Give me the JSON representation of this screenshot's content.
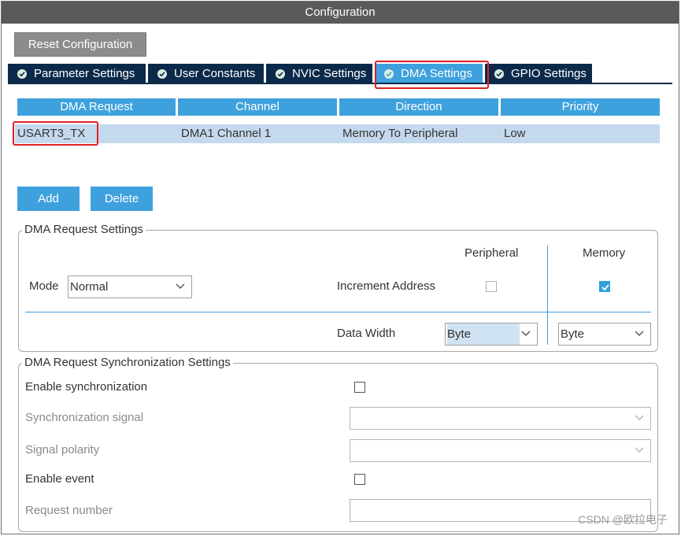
{
  "window": {
    "title": "Configuration"
  },
  "toolbar": {
    "reset_label": "Reset Configuration"
  },
  "tabs": [
    {
      "label": "Parameter Settings",
      "active": false
    },
    {
      "label": "User Constants",
      "active": false
    },
    {
      "label": "NVIC Settings",
      "active": false
    },
    {
      "label": "DMA Settings",
      "active": true
    },
    {
      "label": "GPIO Settings",
      "active": false
    }
  ],
  "dma_table": {
    "headers": [
      "DMA Request",
      "Channel",
      "Direction",
      "Priority"
    ],
    "rows": [
      {
        "request": "USART3_TX",
        "channel": "DMA1 Channel 1",
        "direction": "Memory To Peripheral",
        "priority": "Low"
      }
    ]
  },
  "actions": {
    "add_label": "Add",
    "delete_label": "Delete"
  },
  "request_settings": {
    "legend": "DMA Request Settings",
    "mode_label": "Mode",
    "mode_value": "Normal",
    "peripheral_label": "Peripheral",
    "memory_label": "Memory",
    "increment_label": "Increment Address",
    "peripheral_increment": false,
    "memory_increment": true,
    "data_width_label": "Data Width",
    "peripheral_width": "Byte",
    "memory_width": "Byte"
  },
  "sync_settings": {
    "legend": "DMA Request Synchronization Settings",
    "enable_sync_label": "Enable synchronization",
    "sync_signal_label": "Synchronization signal",
    "signal_polarity_label": "Signal polarity",
    "enable_event_label": "Enable event",
    "request_number_label": "Request number"
  },
  "watermark": "CSDN @欧拉电子",
  "colors": {
    "tab_bg": "#0b2a4a",
    "tab_active": "#3ea1dd",
    "header_blue": "#3ea1dd",
    "row_selected": "#c4d9ee",
    "highlight_red": "#e02020"
  }
}
